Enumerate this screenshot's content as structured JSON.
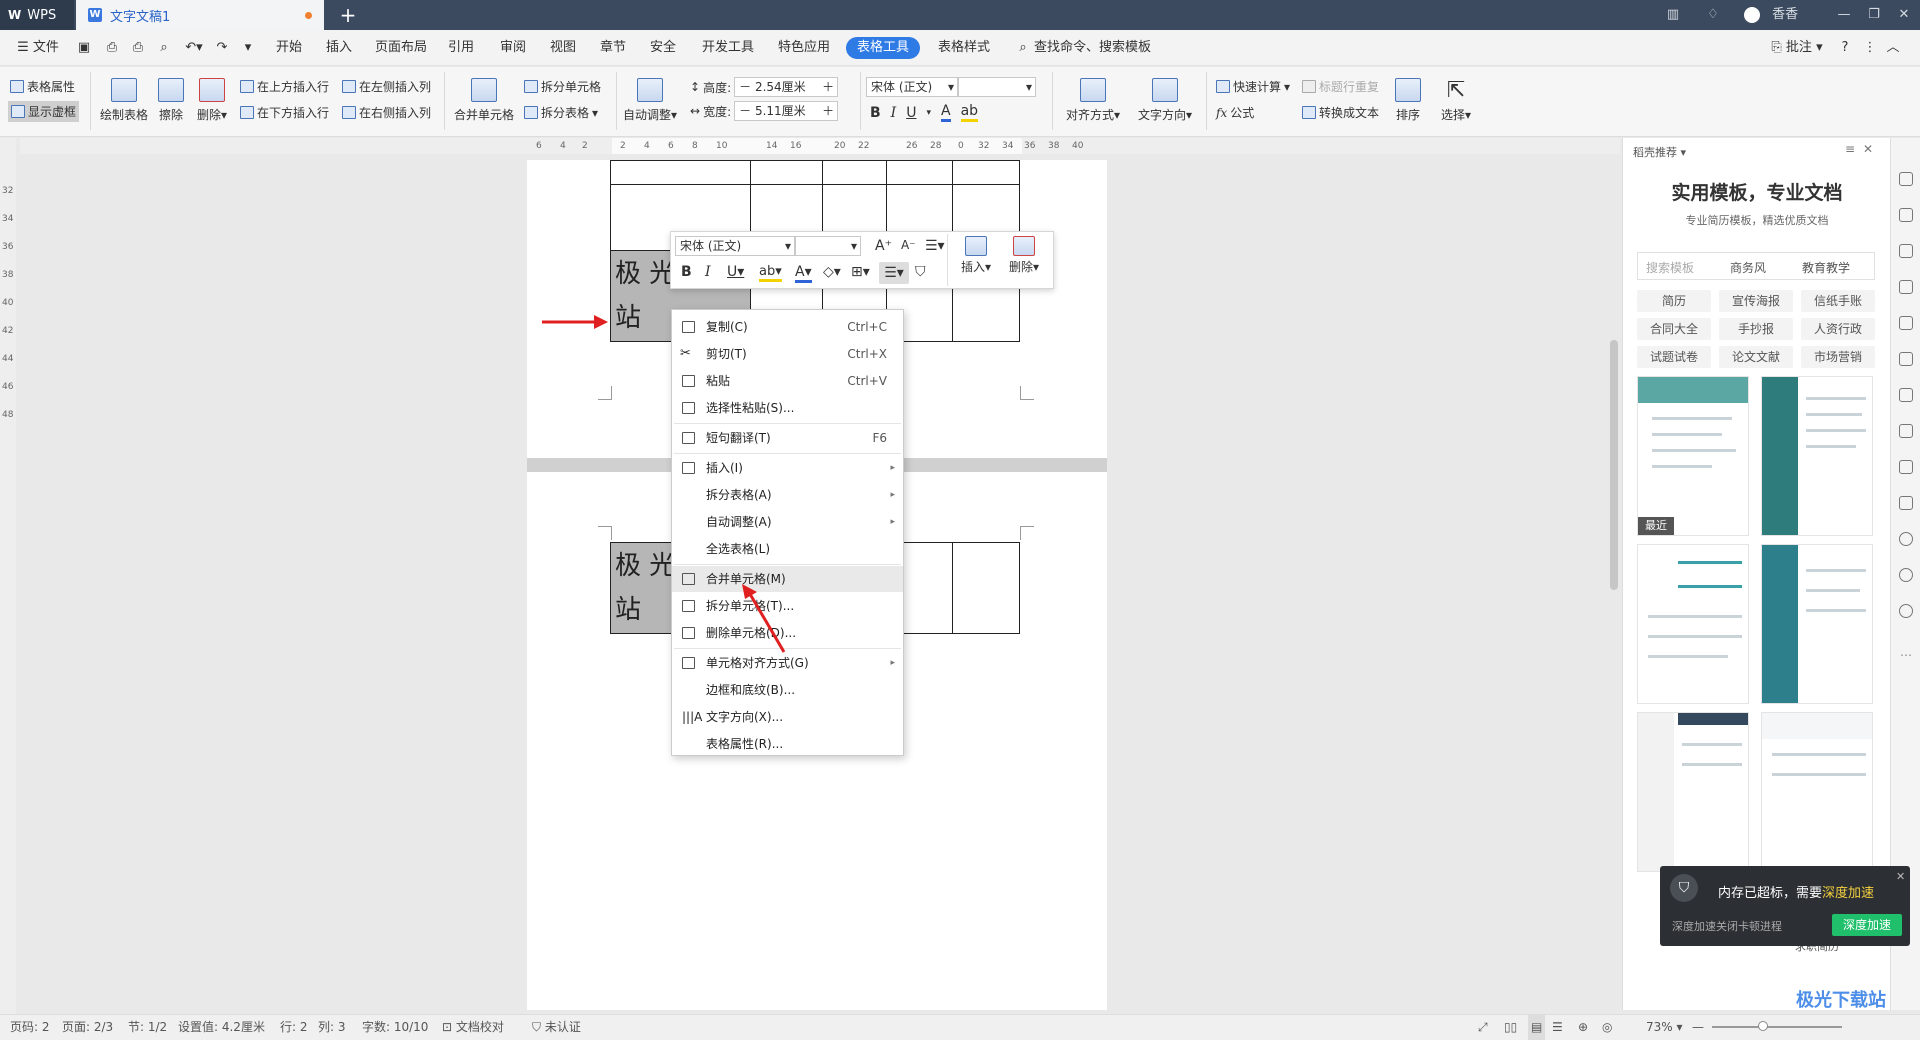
{
  "titlebar": {
    "app_tab": "WPS",
    "doc_tab": "文字文稿1",
    "new_tab": "+",
    "user": "香香",
    "window_controls": [
      "minimize-icon",
      "restore-icon",
      "close-icon"
    ]
  },
  "menubar": {
    "file": "文件",
    "items": [
      "开始",
      "插入",
      "页面布局",
      "引用",
      "审阅",
      "视图",
      "章节",
      "安全",
      "开发工具",
      "特色应用",
      "表格工具",
      "表格样式"
    ],
    "active": "表格工具",
    "search": "查找命令、搜索模板",
    "comment": "批注"
  },
  "ribbon": {
    "table_props": "表格属性",
    "show_virtual": "显示虚框",
    "draw_table": "绘制表格",
    "erase": "擦除",
    "delete": "删除",
    "insert_above": "在上方插入行",
    "insert_below": "在下方插入行",
    "insert_left": "在左侧插入列",
    "insert_right": "在右侧插入列",
    "merge_cells": "合并单元格",
    "split_cells": "拆分单元格",
    "split_table": "拆分表格",
    "auto_fit": "自动调整",
    "height_label": "高度:",
    "height_value": "2.54厘米",
    "width_label": "宽度:",
    "width_value": "5.11厘米",
    "font_name": "宋体 (正文)",
    "font_size": "",
    "align": "对齐方式",
    "text_dir": "文字方向",
    "quick_calc": "快速计算",
    "repeat_header": "标题行重复",
    "formula": "公式",
    "to_text": "转换成文本",
    "sort": "排序",
    "select": "选择"
  },
  "ruler": {
    "labels": [
      "6",
      "4",
      "2",
      "2",
      "4",
      "6",
      "8",
      "10",
      "14",
      "16",
      "20",
      "22",
      "26",
      "28",
      "0",
      "32",
      "34",
      "36",
      "38",
      "40"
    ],
    "vlabels": [
      "32",
      "34",
      "36",
      "38",
      "40",
      "42",
      "44",
      "46",
      "48"
    ]
  },
  "document": {
    "cell_text_line1": "极 光",
    "cell_text_line2": "站"
  },
  "mini_toolbar": {
    "font_name": "宋体 (正文)",
    "font_size": "",
    "insert": "插入",
    "delete": "删除"
  },
  "context_menu": {
    "items": [
      {
        "label": "复制(C)",
        "shortcut": "Ctrl+C"
      },
      {
        "label": "剪切(T)",
        "shortcut": "Ctrl+X"
      },
      {
        "label": "粘贴",
        "shortcut": "Ctrl+V"
      },
      {
        "label": "选择性粘贴(S)...",
        "shortcut": ""
      },
      {
        "label": "短句翻译(T)",
        "shortcut": "F6"
      },
      {
        "label": "插入(I)",
        "shortcut": ""
      },
      {
        "label": "拆分表格(A)",
        "shortcut": ""
      },
      {
        "label": "自动调整(A)",
        "shortcut": ""
      },
      {
        "label": "全选表格(L)",
        "shortcut": ""
      },
      {
        "label": "合并单元格(M)",
        "shortcut": ""
      },
      {
        "label": "拆分单元格(T)...",
        "shortcut": ""
      },
      {
        "label": "删除单元格(D)...",
        "shortcut": ""
      },
      {
        "label": "单元格对齐方式(G)",
        "shortcut": ""
      },
      {
        "label": "边框和底纹(B)...",
        "shortcut": ""
      },
      {
        "label": "文字方向(X)...",
        "shortcut": ""
      },
      {
        "label": "表格属性(R)...",
        "shortcut": ""
      }
    ],
    "highlighted": "合并单元格(M)"
  },
  "right_panel": {
    "header": "稻壳推荐",
    "title": "实用模板，专业文档",
    "subtitle": "专业简历模板，精选优质文档",
    "search_placeholder": "搜索模板",
    "search_tags": [
      "商务风",
      "教育教学"
    ],
    "categories": [
      "简历",
      "宣传海报",
      "信纸手账",
      "合同大全",
      "手抄报",
      "人资行政",
      "试题试卷",
      "论文文献",
      "市场营销"
    ],
    "recent_badge": "最近",
    "template_caption": "求职简历"
  },
  "notification": {
    "text_a": "内存已超标，需要",
    "text_b": "深度加速",
    "sub": "深度加速关闭卡顿进程",
    "button": "深度加速"
  },
  "statusbar": {
    "page_num": "页码: 2",
    "pages": "页面: 2/3",
    "section": "节: 1/2",
    "setting": "设置值: 4.2厘米",
    "row": "行: 2",
    "col": "列: 3",
    "words": "字数: 10/10",
    "proof": "文档校对",
    "cert": "未认证",
    "zoom": "73%"
  },
  "watermark": "极光下载站",
  "colors": {
    "accent": "#2f7be5",
    "arrow": "#e02020",
    "notif_accent": "#f4d03f",
    "notif_button": "#1fbf6b"
  }
}
